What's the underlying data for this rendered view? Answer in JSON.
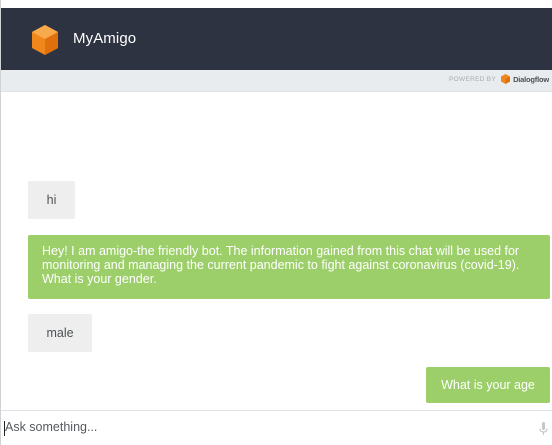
{
  "app": {
    "title": "MyAmigo",
    "colors": {
      "header_bg": "#2d3340",
      "bot_bubble": "#9ccf6a",
      "user_bubble": "#eeeeee",
      "logo": "#f0871d"
    }
  },
  "powered_by": {
    "label": "POWERED BY",
    "brand": "Dialogflow",
    "icon": "dialogflow-icon"
  },
  "messages": [
    {
      "from": "user",
      "text": "hi"
    },
    {
      "from": "bot",
      "text": "Hey! I am amigo-the friendly bot. The information gained from this chat will be used for monitoring and managing the current pandemic to fight against coronavirus (covid-19). What is your gender."
    },
    {
      "from": "user",
      "text": "male"
    },
    {
      "from": "bot",
      "text": "What is your age"
    }
  ],
  "input": {
    "placeholder": "Ask something...",
    "value": "",
    "mic_icon": "microphone-icon"
  }
}
